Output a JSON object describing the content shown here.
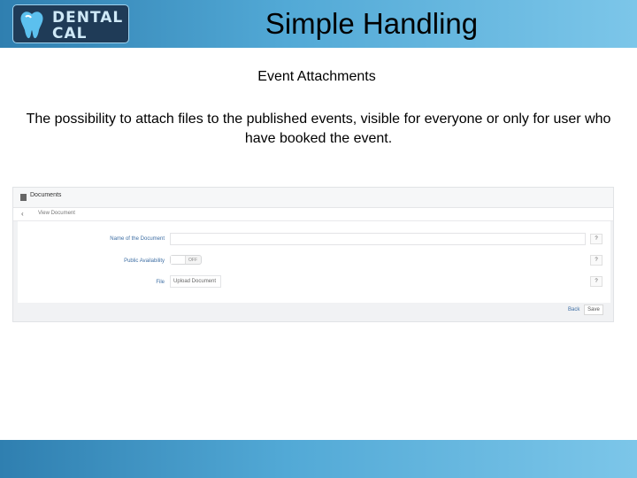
{
  "header": {
    "logo_line1": "DENTAL",
    "logo_line2": "CAL",
    "title": "Simple Handling"
  },
  "content": {
    "subtitle": "Event Attachments",
    "description": "The possibility to attach files to the published events, visible for everyone or only for user who have booked the event."
  },
  "screenshot": {
    "panel_title": "Documents",
    "breadcrumb": "View Document",
    "fields": [
      {
        "label": "Name of the Document",
        "value": "",
        "help": "?"
      },
      {
        "label": "Public Availability",
        "value": "OFF",
        "help": "?"
      },
      {
        "label": "File",
        "value": "Upload Document",
        "help": "?"
      }
    ],
    "back_label": "Back",
    "save_label": "Save"
  },
  "colors": {
    "banner_start": "#2f7fb0",
    "banner_end": "#7cc6e9",
    "logo_bg": "#1f3b57",
    "link_blue": "#3f6fa4"
  }
}
